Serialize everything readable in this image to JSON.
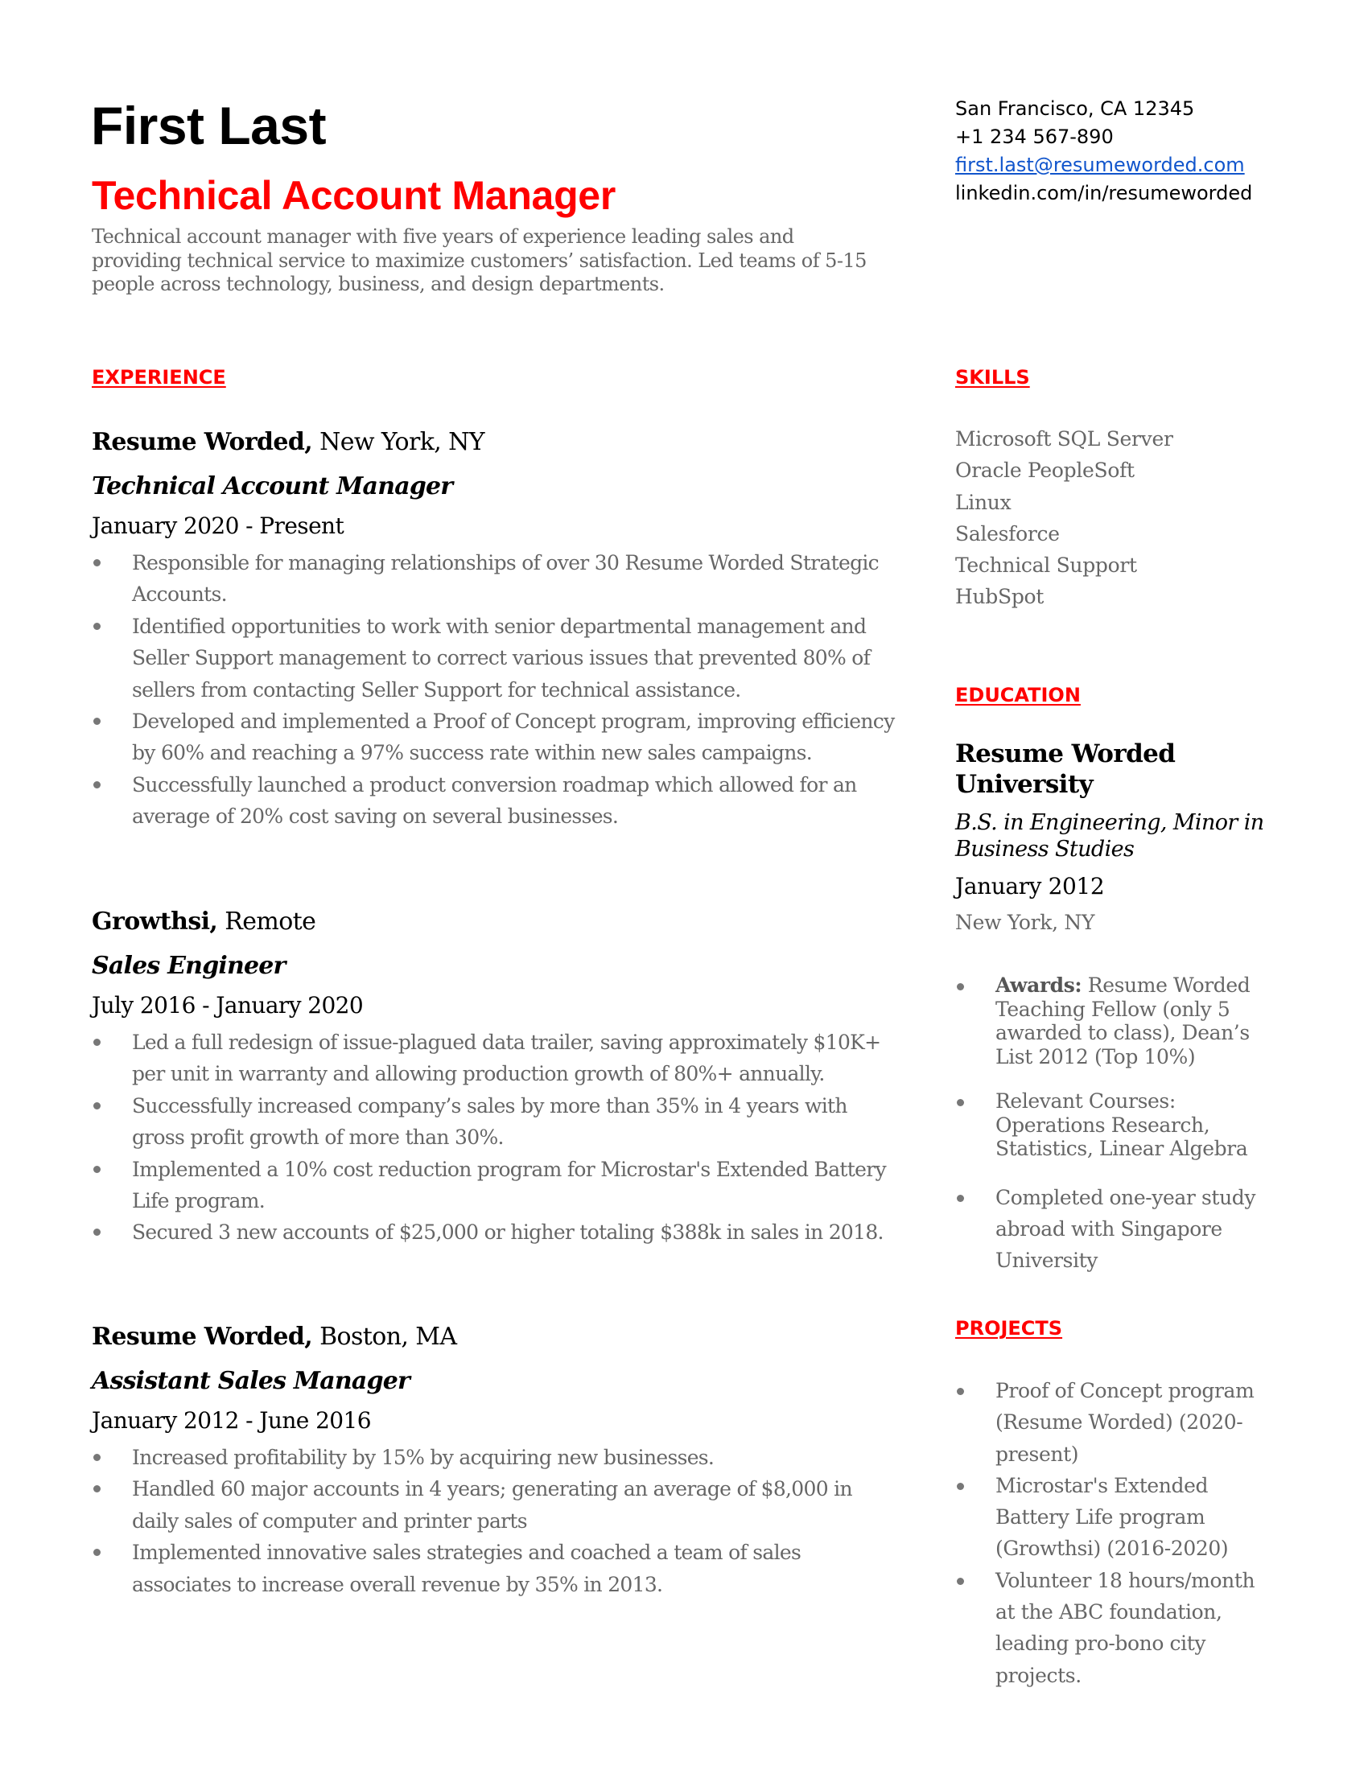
{
  "header": {
    "name": "First Last",
    "title": "Technical Account Manager",
    "summary": "Technical account manager with five years of experience leading sales and providing technical service to maximize customers’ satisfaction. Led teams of 5-15 people across technology, business, and design departments."
  },
  "contact": {
    "location": "San Francisco, CA 12345",
    "phone": "+1 234 567-890",
    "email": "first.last@resumeworded.com",
    "linkedin": "linkedin.com/in/resumeworded"
  },
  "colors": {
    "accent": "#ff0000",
    "link": "#1155cc",
    "body_text": "#666666",
    "heading_text": "#000000"
  },
  "sections": {
    "experience": "EXPERIENCE",
    "skills": "SKILLS",
    "education": "EDUCATION",
    "projects": "PROJECTS"
  },
  "experience": [
    {
      "company": "Resume Worded,",
      "location": " New York, NY",
      "role": "Technical Account Manager",
      "dates": "January 2020 - Present",
      "bullets": [
        "Responsible for managing relationships of over 30 Resume Worded Strategic Accounts.",
        "Identified opportunities to work with senior departmental management and Seller Support management to correct various issues that prevented 80% of sellers from contacting Seller Support for technical assistance.",
        "Developed and implemented a Proof of Concept program, improving efficiency by 60% and reaching a 97% success rate within new sales campaigns.",
        "Successfully launched a product conversion roadmap which allowed for an average of 20% cost saving on several businesses."
      ]
    },
    {
      "company": "Growthsi,",
      "location": " Remote",
      "role": "Sales Engineer",
      "dates": "July 2016 - January 2020",
      "bullets": [
        "Led a full redesign of issue-plagued data trailer, saving approximately $10K+ per unit in warranty and allowing production growth of 80%+ annually.",
        "Successfully increased company’s sales by more than 35% in 4 years with gross profit growth of more than 30%.",
        "Implemented a 10% cost reduction program for Microstar's Extended Battery Life program.",
        "Secured 3 new accounts of $25,000 or higher totaling $388k in sales in 2018."
      ]
    },
    {
      "company": "Resume Worded,",
      "location": " Boston, MA",
      "role": "Assistant Sales Manager",
      "dates": "January 2012 - June 2016",
      "bullets": [
        "Increased profitability by 15% by acquiring new businesses.",
        "Handled 60 major accounts in 4 years; generating an average of $8,000 in daily sales of computer and printer parts",
        "Implemented innovative sales strategies and coached a team of sales associates to increase overall revenue by 35% in 2013."
      ]
    }
  ],
  "skills": [
    "Microsoft SQL Server",
    "Oracle PeopleSoft",
    "Linux",
    "Salesforce",
    "Technical Support",
    "HubSpot"
  ],
  "education": {
    "school": "Resume Worded University",
    "degree": "B.S. in Engineering, Minor in Business Studies",
    "date": "January 2012",
    "location": "New York, NY",
    "bullets": [
      {
        "label": "Awards:",
        "text": " Resume Worded Teaching Fellow (only 5 awarded to class), Dean’s List 2012 (Top 10%)"
      },
      {
        "label": "",
        "text": "Relevant Courses: Operations Research, Statistics, Linear Algebra"
      },
      {
        "label": "",
        "text": "Completed one-year study abroad with Singapore University"
      }
    ]
  },
  "projects": [
    "Proof of Concept program (Resume Worded) (2020-present)",
    "Microstar's Extended Battery Life program (Growthsi) (2016-2020)",
    "Volunteer 18 hours/month at the ABC foundation, leading pro-bono city projects."
  ]
}
